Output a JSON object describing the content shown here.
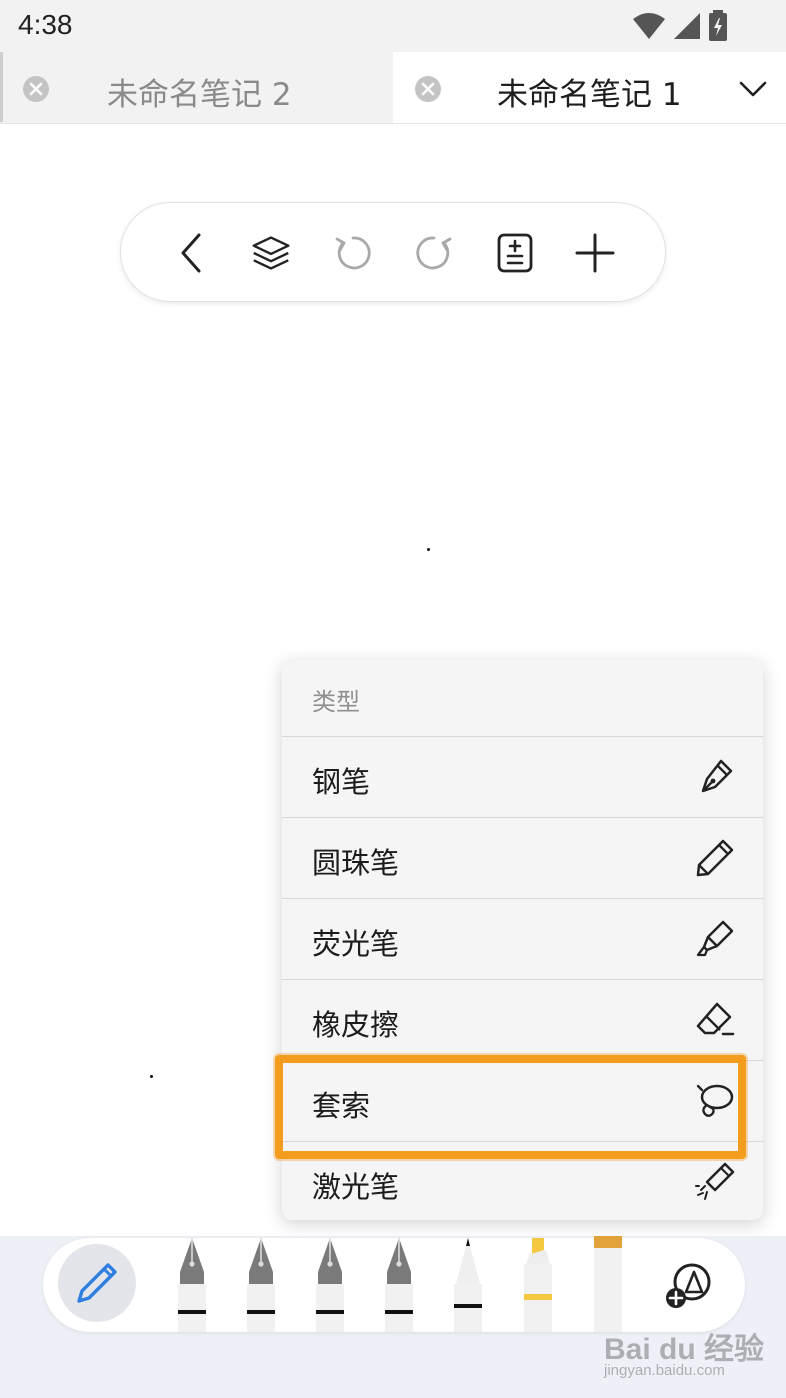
{
  "status_bar": {
    "time": "4:38"
  },
  "tabs": [
    {
      "title": "未命名笔记 2",
      "active": false
    },
    {
      "title": "未命名笔记 1",
      "active": true
    }
  ],
  "toolbar": {
    "buttons": [
      "back-icon",
      "layers-icon",
      "undo-icon",
      "redo-icon",
      "page-add-icon",
      "add-icon"
    ]
  },
  "menu": {
    "header": "类型",
    "items": [
      {
        "label": "钢笔",
        "icon": "fountain-pen-icon"
      },
      {
        "label": "圆珠笔",
        "icon": "ballpoint-pen-icon"
      },
      {
        "label": "荧光笔",
        "icon": "highlighter-icon"
      },
      {
        "label": "橡皮擦",
        "icon": "eraser-icon"
      },
      {
        "label": "套索",
        "icon": "lasso-icon",
        "highlighted": true
      },
      {
        "label": "激光笔",
        "icon": "laser-pointer-icon"
      }
    ]
  },
  "pen_bar": {
    "active_tool": "pencil-icon",
    "tools": [
      "fountain-pen",
      "fountain-pen",
      "fountain-pen",
      "fountain-pen",
      "marker-pen",
      "highlighter-yellow",
      "highlighter-orange"
    ],
    "end_button": "insert-shape-icon"
  },
  "colors": {
    "highlight": "#f39c1e",
    "active_pen": "#2f7fe0",
    "highlighter": "#f5c842"
  },
  "watermark": {
    "brand": "Bai du 经验",
    "url": "jingyan.baidu.com"
  }
}
